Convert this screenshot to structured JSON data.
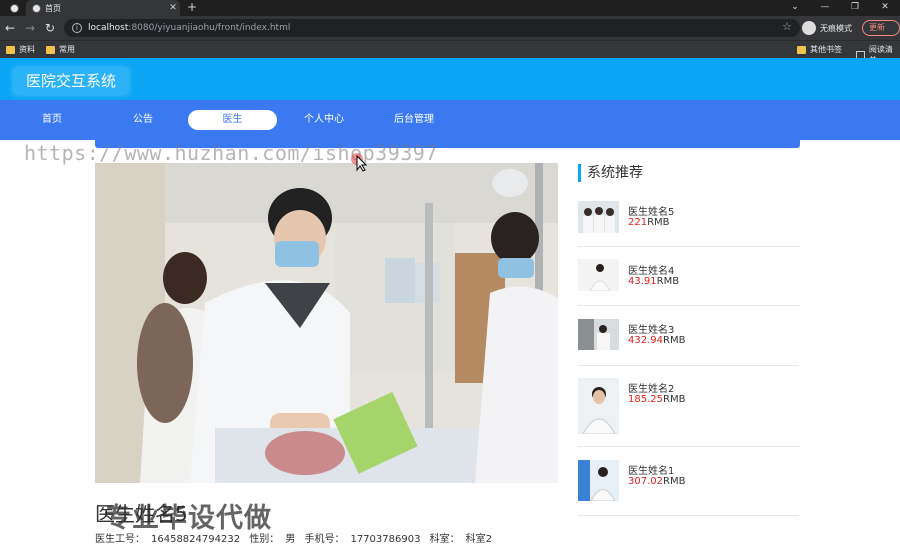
{
  "browser": {
    "tab_title": "首页",
    "url_host": "localhost",
    "url_path": ":8080/yiyuanjiaohu/front/index.html",
    "profile_label": "无痕模式",
    "update_label": "更新",
    "bookmarks": [
      "资料",
      "常用"
    ],
    "bookmarks_right": [
      "其他书签",
      "阅读清单"
    ]
  },
  "site": {
    "logo": "医院交互系统",
    "nav": [
      {
        "label": "首页",
        "active": false
      },
      {
        "label": "公告",
        "active": false
      },
      {
        "label": "医生",
        "active": true
      },
      {
        "label": "个人中心",
        "active": false
      },
      {
        "label": "后台管理",
        "active": false
      }
    ]
  },
  "watermark": "https://www.huzhan.com/ishop39397",
  "stamp": "专业毕设代做",
  "detail": {
    "name": "医生姓名5",
    "id_label": "医生工号：",
    "id_value": "16458824794232",
    "gender_label": "性别：",
    "gender_value": "男",
    "phone_label": "手机号：",
    "phone_value": "17703786903",
    "dept_label": "科室：",
    "dept_value": "科室2"
  },
  "recommend": {
    "title": "系统推荐",
    "items": [
      {
        "name": "医生姓名5",
        "price": "221",
        "unit": "RMB"
      },
      {
        "name": "医生姓名4",
        "price": "43.91",
        "unit": "RMB"
      },
      {
        "name": "医生姓名3",
        "price": "432.94",
        "unit": "RMB"
      },
      {
        "name": "医生姓名2",
        "price": "185.25",
        "unit": "RMB"
      },
      {
        "name": "医生姓名1",
        "price": "307.02",
        "unit": "RMB"
      }
    ]
  },
  "colors": {
    "header": "#0aa6f5",
    "navbar": "#3a79f0",
    "price": "#e02020"
  }
}
